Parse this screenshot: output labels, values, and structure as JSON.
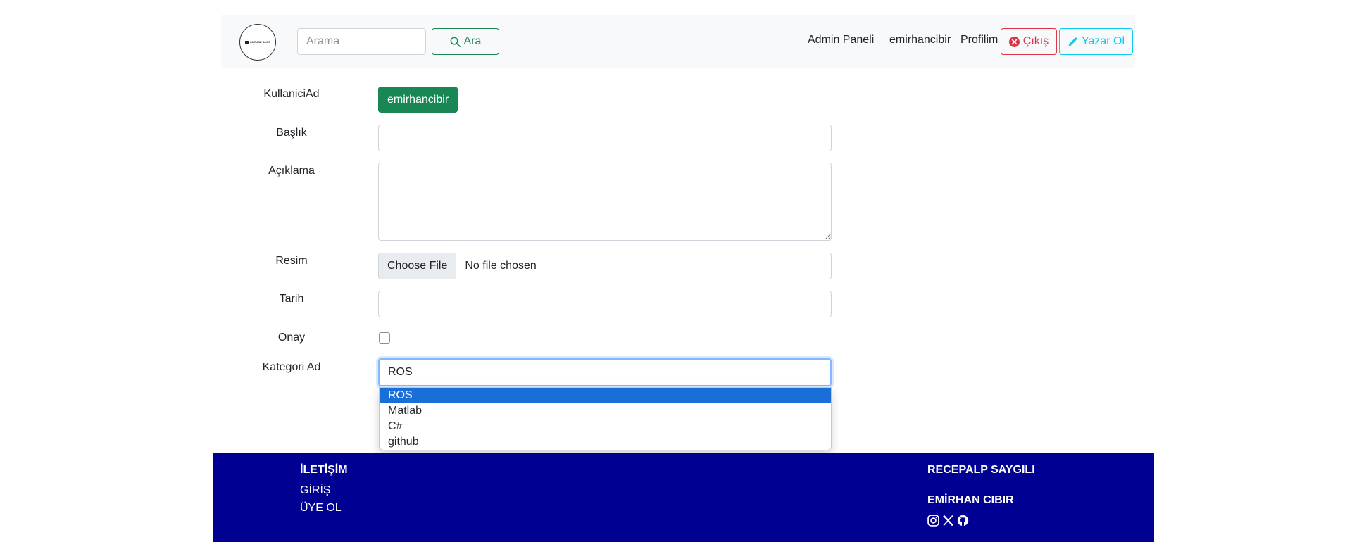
{
  "navbar": {
    "logo_text": "OUTUBE BLOG",
    "search_placeholder": "Arama",
    "search_button": "Ara",
    "links": {
      "admin": "Admin Paneli",
      "username": "emirhancibir",
      "profile": "Profilim"
    },
    "logout_button": "Çıkış",
    "writer_button": "Yazar Ol"
  },
  "form": {
    "labels": {
      "username": "KullaniciAd",
      "title": "Başlık",
      "description": "Açıklama",
      "image": "Resim",
      "date": "Tarih",
      "approval": "Onay",
      "category": "Kategori Ad"
    },
    "username_value": "emirhancibir",
    "title_value": "",
    "description_value": "",
    "file_button": "Choose File",
    "file_status": "No file chosen",
    "date_value": "",
    "approval_checked": false,
    "category_selected": "ROS",
    "category_options": [
      "ROS",
      "Matlab",
      "C#",
      "github"
    ]
  },
  "footer": {
    "contact_heading": "İLETİŞİM",
    "login_link": "GİRİŞ",
    "register_link": "ÜYE OL",
    "credit_1": "RECEPALP SAYGILI",
    "credit_2": "EMİRHAN CIBIR",
    "social_icons": [
      "instagram-icon",
      "x-icon",
      "github-icon"
    ]
  },
  "colors": {
    "success": "#198754",
    "danger": "#dc3545",
    "info": "#0dcaf0",
    "footer_bg": "#000093",
    "select_highlight": "#1a6ed8"
  }
}
